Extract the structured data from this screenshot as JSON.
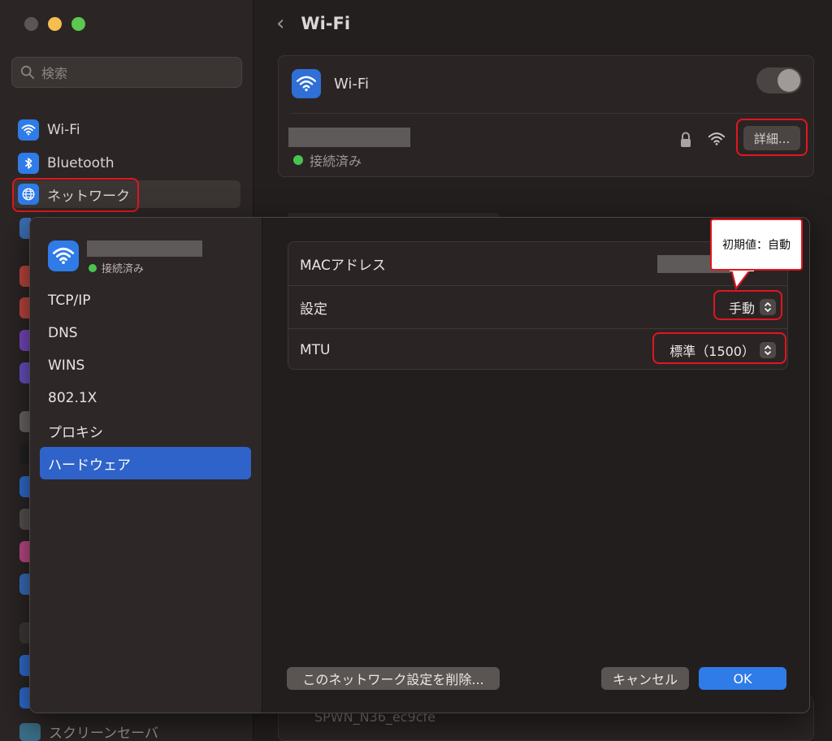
{
  "window": {
    "search_placeholder": "検索",
    "header_title": "Wi-Fi",
    "back_glyph": "‹"
  },
  "sidebar": {
    "items": [
      {
        "label": "Wi-Fi",
        "icon": "wifi-icon"
      },
      {
        "label": "Bluetooth",
        "icon": "bluetooth-icon"
      },
      {
        "label": "ネットワーク",
        "icon": "globe-icon",
        "selected": true
      }
    ],
    "bottom_item": {
      "label": "スクリーンセーバ",
      "icon": "screensaver-icon"
    }
  },
  "wifi_card": {
    "label": "Wi-Fi",
    "toggle_on": true,
    "status": "接続済み",
    "details_button": "詳細..."
  },
  "network_list": {
    "ssid": "SPWN_N36_ec9cfe"
  },
  "sheet": {
    "status": "接続済み",
    "nav": [
      {
        "label": "TCP/IP"
      },
      {
        "label": "DNS"
      },
      {
        "label": "WINS"
      },
      {
        "label": "802.1X"
      },
      {
        "label": "プロキシ"
      },
      {
        "label": "ハードウェア",
        "active": true
      }
    ],
    "hardware": {
      "mac_label": "MACアドレス",
      "config_label": "設定",
      "config_value": "手動",
      "mtu_label": "MTU",
      "mtu_value": "標準（1500）"
    },
    "buttons": {
      "delete": "このネットワーク設定を削除...",
      "cancel": "キャンセル",
      "ok": "OK"
    }
  },
  "annotation": {
    "callout_text": "初期値：自動"
  },
  "colors": {
    "accent": "#2f7be8",
    "highlight_red": "#e0161f",
    "connected_green": "#48c351"
  }
}
